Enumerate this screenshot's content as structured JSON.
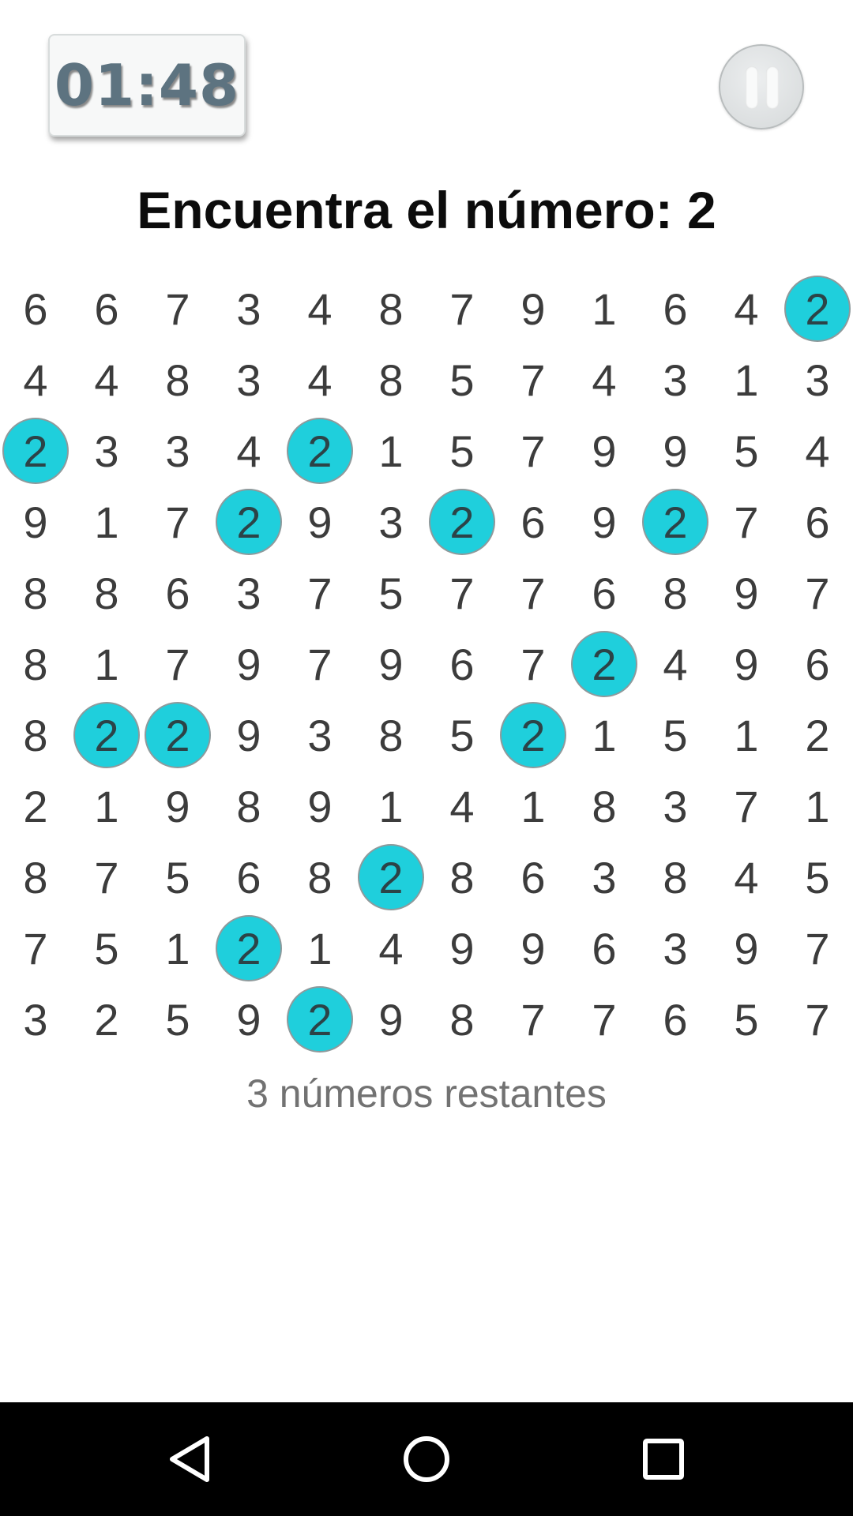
{
  "timer": {
    "value": "01:48"
  },
  "pause_button": {
    "icon": "pause-icon"
  },
  "instruction": {
    "text": "Encuentra el número: 2",
    "target": 2
  },
  "accent_color": "#1fcfdc",
  "grid": {
    "rows": [
      [
        "6",
        "6",
        "7",
        "3",
        "4",
        "8",
        "7",
        "9",
        "1",
        "6",
        "4",
        "2"
      ],
      [
        "4",
        "4",
        "8",
        "3",
        "4",
        "8",
        "5",
        "7",
        "4",
        "3",
        "1",
        "3"
      ],
      [
        "2",
        "3",
        "3",
        "4",
        "2",
        "1",
        "5",
        "7",
        "9",
        "9",
        "5",
        "4"
      ],
      [
        "9",
        "1",
        "7",
        "2",
        "9",
        "3",
        "2",
        "6",
        "9",
        "2",
        "7",
        "6"
      ],
      [
        "8",
        "8",
        "6",
        "3",
        "7",
        "5",
        "7",
        "7",
        "6",
        "8",
        "9",
        "7"
      ],
      [
        "8",
        "1",
        "7",
        "9",
        "7",
        "9",
        "6",
        "7",
        "2",
        "4",
        "9",
        "6"
      ],
      [
        "8",
        "2",
        "2",
        "9",
        "3",
        "8",
        "5",
        "2",
        "1",
        "5",
        "1",
        "2"
      ],
      [
        "2",
        "1",
        "9",
        "8",
        "9",
        "1",
        "4",
        "1",
        "8",
        "3",
        "7",
        "1"
      ],
      [
        "8",
        "7",
        "5",
        "6",
        "8",
        "2",
        "8",
        "6",
        "3",
        "8",
        "4",
        "5"
      ],
      [
        "7",
        "5",
        "1",
        "2",
        "1",
        "4",
        "9",
        "9",
        "6",
        "3",
        "9",
        "7"
      ],
      [
        "3",
        "2",
        "5",
        "9",
        "2",
        "9",
        "8",
        "7",
        "7",
        "6",
        "5",
        "7"
      ]
    ],
    "found": [
      [
        0,
        11
      ],
      [
        2,
        0
      ],
      [
        2,
        4
      ],
      [
        3,
        3
      ],
      [
        3,
        6
      ],
      [
        3,
        9
      ],
      [
        5,
        8
      ],
      [
        6,
        1
      ],
      [
        6,
        2
      ],
      [
        6,
        7
      ],
      [
        8,
        5
      ],
      [
        9,
        3
      ],
      [
        10,
        4
      ]
    ]
  },
  "status": {
    "remaining_text": "3 números restantes"
  },
  "navbar": {
    "back_icon": "back-triangle-icon",
    "home_icon": "home-circle-icon",
    "recents_icon": "recents-square-icon"
  }
}
